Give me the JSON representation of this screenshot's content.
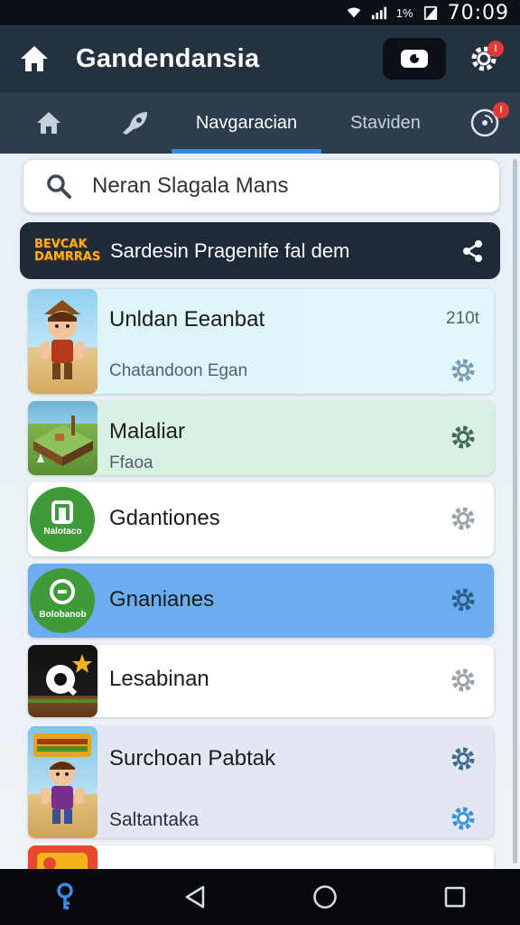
{
  "status_bar": {
    "time": "70:09",
    "battery_text": "1%"
  },
  "app_bar": {
    "title": "Gandendansia"
  },
  "tabs": [
    {
      "label": "",
      "icon": "home-icon"
    },
    {
      "label": "",
      "icon": "rocket-icon"
    },
    {
      "label": "Navgaracian",
      "active": true
    },
    {
      "label": "Staviden"
    },
    {
      "label": "",
      "icon": "vinyl-icon"
    }
  ],
  "search": {
    "value": "Neran Slagala Mans"
  },
  "banner": {
    "logo_line1": "BEVCAK",
    "logo_line2": "DAMRRAS",
    "text": "Sardesin Pragenife fal dem"
  },
  "items": [
    {
      "title": "Unldan Eeanbat",
      "subtitle": "Chatandoon Egan",
      "meta": "210t"
    },
    {
      "title": "Malaliar",
      "subtitle": "Ffaoa"
    },
    {
      "title": "Gdantiones",
      "thumb_text": "Nalotaco"
    },
    {
      "title": "Gnanianes",
      "thumb_text": "Bolobanob"
    },
    {
      "title": "Lesabinan"
    },
    {
      "title": "Surchoan Pabtak",
      "subtitle": "Saltantaka"
    }
  ],
  "colors": {
    "accent": "#2f8ad8",
    "header": "#243140",
    "tabbar": "#2d3c4e",
    "selected_item": "#6aaef0",
    "badge": "#e53935"
  }
}
